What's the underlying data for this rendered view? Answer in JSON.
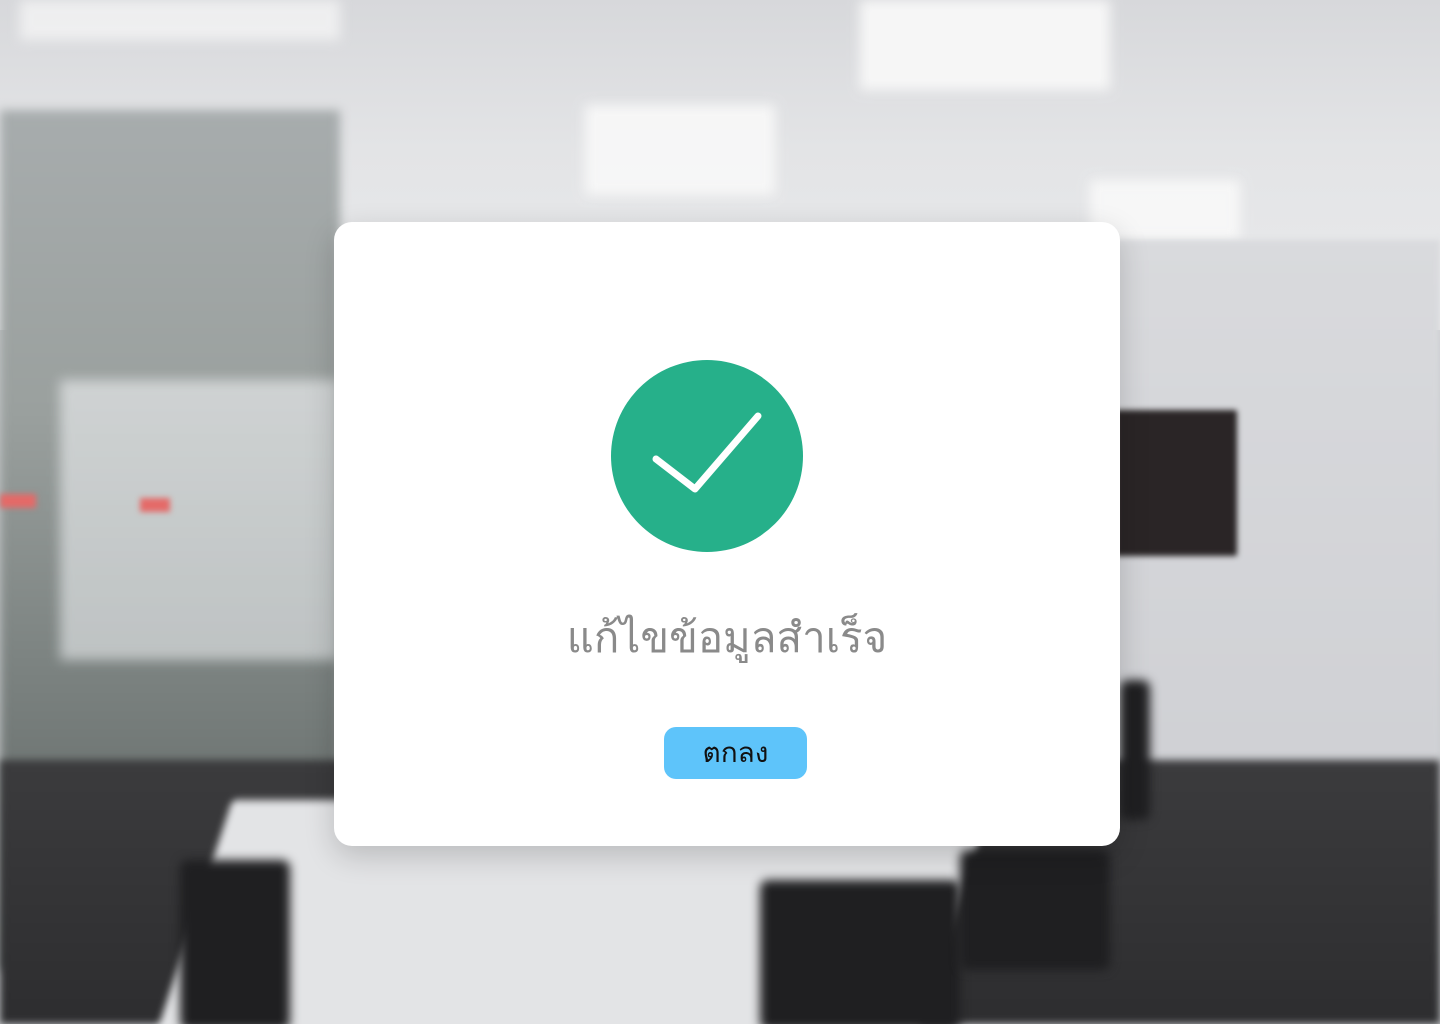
{
  "dialog": {
    "icon": "check-circle-icon",
    "accent_color": "#26b08a",
    "message": "แก้ไขข้อมูลสำเร็จ",
    "ok_label": "ตกลง",
    "button_color": "#5ec4fa"
  }
}
